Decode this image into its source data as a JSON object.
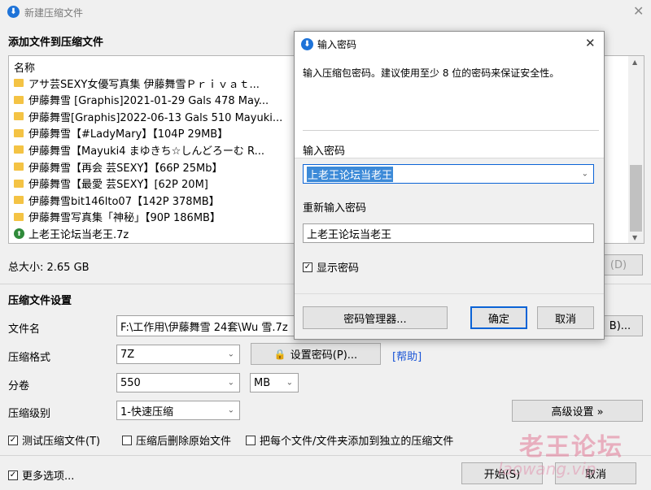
{
  "window": {
    "title": "新建压缩文件",
    "close_glyph": "✕"
  },
  "add_files": {
    "heading": "添加文件到压缩文件",
    "column_header": "名称",
    "items": [
      {
        "name": "アサ芸SEXY女優写真集 伊藤舞雪Ｐｒｉｖａｔ...",
        "icon": "folder-icon"
      },
      {
        "name": "伊藤舞雪 [Graphis]2021-01-29 Gals 478 May...",
        "icon": "folder-icon"
      },
      {
        "name": "伊藤舞雪[Graphis]2022-06-13 Gals 510 Mayuki...",
        "icon": "folder-icon"
      },
      {
        "name": "伊藤舞雪【#LadyMary】【104P 29MB】",
        "icon": "folder-icon"
      },
      {
        "name": "伊藤舞雪【Mayuki4 まゆきち☆しんどろーむ R...",
        "icon": "folder-icon"
      },
      {
        "name": "伊藤舞雪【再会 芸SEXY】【66P 25Mb】",
        "icon": "folder-icon"
      },
      {
        "name": "伊藤舞雪【最愛 芸SEXY】[62P 20M]",
        "icon": "folder-icon"
      },
      {
        "name": "伊藤舞雪bit146lto07【142P 378MB】",
        "icon": "folder-icon"
      },
      {
        "name": "伊藤舞雪写真集「神秘」【90P 186MB】",
        "icon": "folder-icon"
      },
      {
        "name": "上老王论坛当老王.7z",
        "icon": "archive-icon"
      }
    ],
    "total_size": "总大小: 2.65 GB",
    "delete_button": "(D)"
  },
  "settings": {
    "heading": "压缩文件设置",
    "filename_label": "文件名",
    "filename_value": "F:\\工作用\\伊藤舞雪 24套\\Wu 雪.7z",
    "browse_button": "B)...",
    "format_label": "压缩格式",
    "format_value": "7Z",
    "set_password_button": "设置密码(P)...",
    "help_link": "[帮助]",
    "volume_label": "分卷",
    "volume_value": "550",
    "volume_unit": "MB",
    "level_label": "压缩级别",
    "level_value": "1-快速压缩",
    "advanced_button": "高级设置 »",
    "test_checkbox": "测试压缩文件(T)",
    "test_checked": true,
    "delete_checkbox": "压缩后删除原始文件",
    "delete_checked": false,
    "separate_checkbox": "把每个文件/文件夹添加到独立的压缩文件",
    "separate_checked": false
  },
  "footer": {
    "more_options": "更多选项...",
    "more_checked": true,
    "start_button": "开始(S)",
    "cancel_button": "取消"
  },
  "password_dialog": {
    "title": "输入密码",
    "close_glyph": "✕",
    "instruction": "输入压缩包密码。建议使用至少 8 位的密码来保证安全性。",
    "password_label": "输入密码",
    "password_value": "上老王论坛当老王",
    "reenter_label": "重新输入密码",
    "reenter_value": "上老王论坛当老王",
    "show_password": "显示密码",
    "show_checked": true,
    "manager_button": "密码管理器...",
    "ok_button": "确定",
    "cancel_button": "取消"
  },
  "watermark": {
    "line1": "老王论坛",
    "line2": "laowang.vip"
  },
  "colors": {
    "accent": "#0b63d6",
    "selection": "#3c8ad8",
    "folder": "#f4c344"
  }
}
